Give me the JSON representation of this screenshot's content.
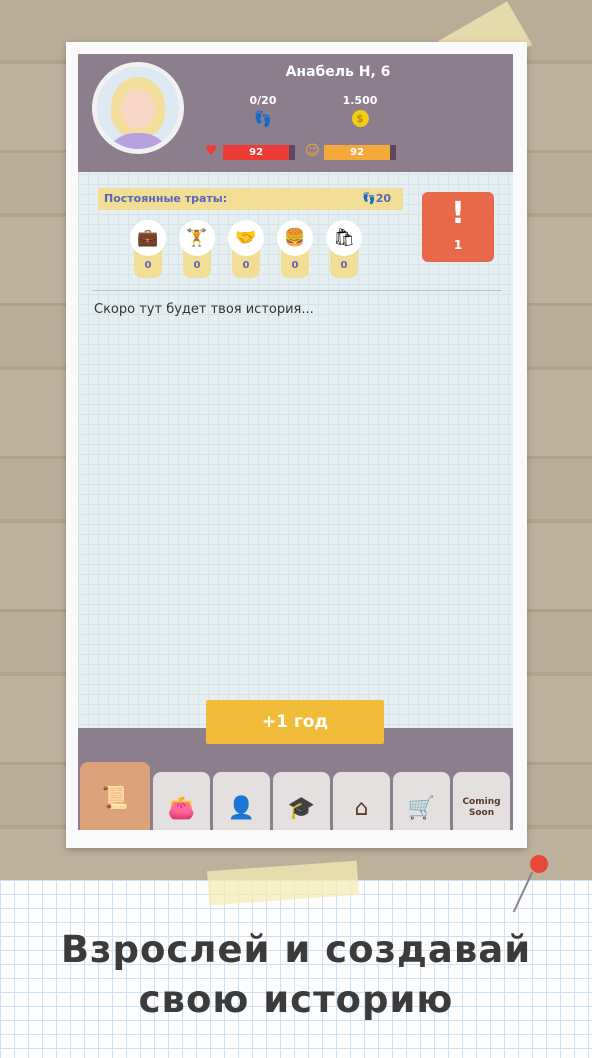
{
  "profile": {
    "name": "Анабель Н, 6",
    "energy": "0/20",
    "money": "1.500",
    "health": 92,
    "happiness": 92,
    "health_label": "92",
    "happiness_label": "92"
  },
  "expenses": {
    "title": "Постоянные траты:",
    "energy_cost": "20",
    "items": [
      {
        "icon": "briefcase-icon",
        "glyph": "💼",
        "value": "0"
      },
      {
        "icon": "dumbbell-icon",
        "glyph": "🏋",
        "value": "0"
      },
      {
        "icon": "handshake-icon",
        "glyph": "🤝",
        "value": "0"
      },
      {
        "icon": "burger-icon",
        "glyph": "🍔",
        "value": "0"
      },
      {
        "icon": "groceries-icon",
        "glyph": "🛍",
        "value": "0"
      }
    ]
  },
  "alert": {
    "symbol": "!",
    "count": "1"
  },
  "story": {
    "placeholder": "Скоро тут будет твоя история..."
  },
  "actions": {
    "next_year": "+1 год"
  },
  "tabs": [
    {
      "name": "tab-story",
      "icon": "scroll-icon",
      "glyph": "📜"
    },
    {
      "name": "tab-finance",
      "icon": "wallet-icon",
      "glyph": "👛"
    },
    {
      "name": "tab-profile",
      "icon": "person-icon",
      "glyph": "👤"
    },
    {
      "name": "tab-education",
      "icon": "graduation-cap-icon",
      "glyph": "🎓"
    },
    {
      "name": "tab-home",
      "icon": "house-icon",
      "glyph": "⌂"
    },
    {
      "name": "tab-shop",
      "icon": "grocery-bag-icon",
      "glyph": "🛒"
    }
  ],
  "coming_soon": "Coming Soon",
  "promo": {
    "line1": "Взрослей и создавай",
    "line2": "свою историю"
  },
  "colors": {
    "header": "#8d7e8d",
    "health": "#ee3b36",
    "happiness": "#f5a93a",
    "accent": "#f0bc3a",
    "alert": "#e8684a"
  }
}
